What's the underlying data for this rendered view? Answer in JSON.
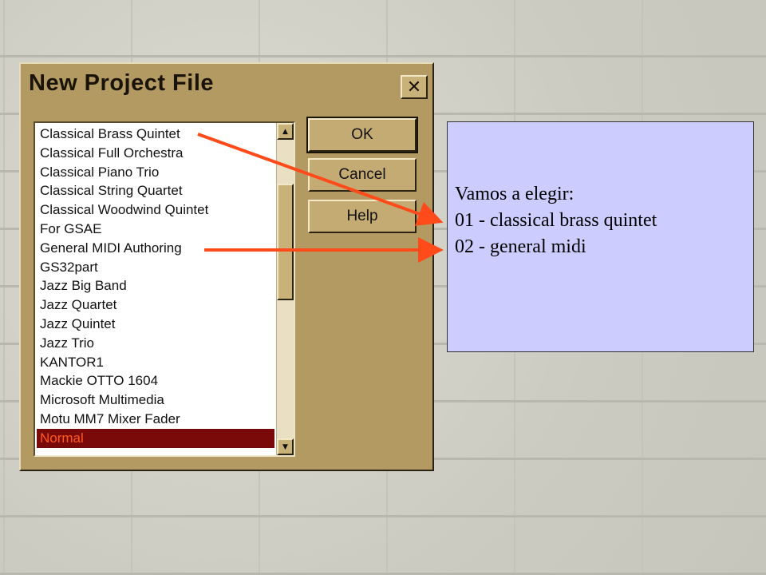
{
  "dialog": {
    "title": "New Project File",
    "close_label": "✕",
    "list": {
      "items": [
        "Classical Brass Quintet",
        "Classical Full Orchestra",
        "Classical Piano Trio",
        "Classical String Quartet",
        "Classical Woodwind Quintet",
        "For GSAE",
        "General MIDI Authoring",
        "GS32part",
        "Jazz Big Band",
        "Jazz Quartet",
        "Jazz Quintet",
        "Jazz Trio",
        "KANTOR1",
        "Mackie OTTO 1604",
        "Microsoft Multimedia",
        "Motu MM7 Mixer Fader",
        "Normal"
      ],
      "selected": "Normal"
    },
    "scrollbar": {
      "up_icon": "▲",
      "down_icon": "▼"
    },
    "buttons": {
      "ok": "OK",
      "cancel": "Cancel",
      "help": "Help"
    }
  },
  "note": {
    "line1": "Vamos a elegir:",
    "line2": "01 - classical brass quintet",
    "line3": "02 - general midi"
  },
  "colors": {
    "arrow": "#ff4a1a",
    "dialog_bg": "#b39a63",
    "note_bg": "#ccccff",
    "selection_bg": "#7a0a0a",
    "selection_text": "#ff5a1a"
  }
}
